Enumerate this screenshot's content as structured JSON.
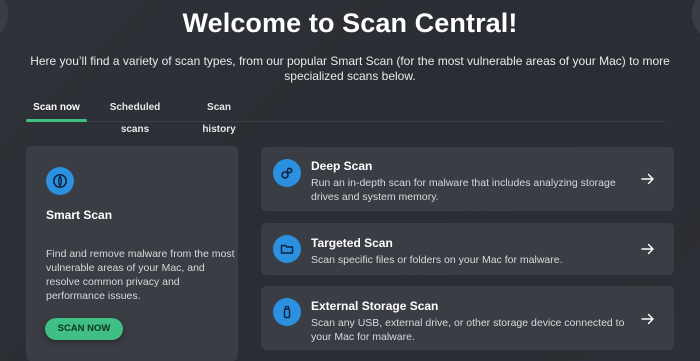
{
  "header": {
    "title": "Welcome to Scan Central!",
    "subtitle": "Here you’ll find a variety of scan types, from our popular Smart Scan (for the most vulnerable areas of your Mac) to more specialized scans below."
  },
  "tabs": [
    {
      "label": "Scan now",
      "active": true
    },
    {
      "label": "Scheduled scans",
      "active": false
    },
    {
      "label": "Scan history",
      "active": false
    }
  ],
  "smart_scan": {
    "icon": "smart-scan-icon",
    "title": "Smart Scan",
    "description": "Find and remove malware from the most vulnerable areas of your Mac, and resolve common privacy and performance issues.",
    "button_label": "SCAN NOW"
  },
  "scans": [
    {
      "icon": "deep-scan-icon",
      "title": "Deep Scan",
      "description": "Run an in-depth scan for malware that includes analyzing storage drives and system memory."
    },
    {
      "icon": "folder-icon",
      "title": "Targeted Scan",
      "description": "Scan specific files or folders on your Mac for malware."
    },
    {
      "icon": "usb-drive-icon",
      "title": "External Storage Scan",
      "description": "Scan any USB, external drive, or other storage device connected to your Mac for malware."
    }
  ],
  "colors": {
    "accent_green": "#3fbf83",
    "icon_blue": "#2b90e0",
    "card_bg": "#3a3d43",
    "page_bg": "#2d3036"
  }
}
